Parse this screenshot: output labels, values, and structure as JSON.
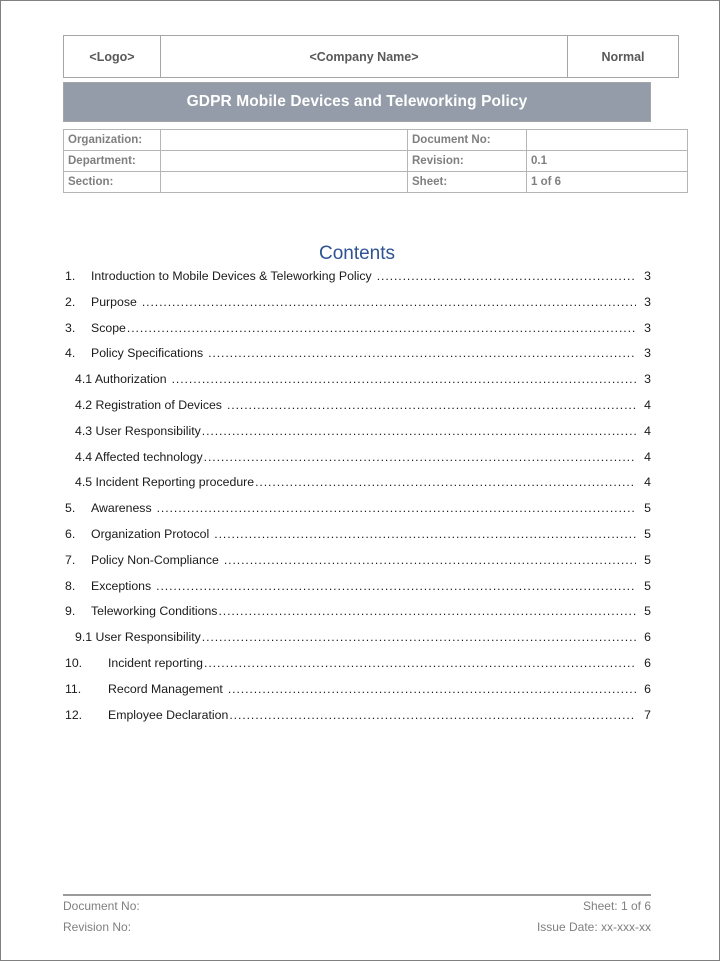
{
  "document": {
    "header_table": {
      "logo_cell": "<Logo>",
      "company_cell": "<Company Name>",
      "status_cell": "Normal"
    },
    "banner_title": "GDPR Mobile Devices and Teleworking Policy",
    "meta_table": {
      "rows": [
        {
          "label_left": "Organization:",
          "value_left": "",
          "label_right": "Document No:",
          "value_right": ""
        },
        {
          "label_left": "Department:",
          "value_left": "",
          "label_right": "Revision:",
          "value_right": "0.1"
        },
        {
          "label_left": "Section:",
          "value_left": "",
          "label_right": "Sheet:",
          "value_right": "1 of 6"
        }
      ]
    },
    "contents_heading": "Contents",
    "toc": [
      {
        "number": "1.",
        "label": "Introduction to Mobile Devices & Teleworking Policy",
        "page": "3",
        "level": 1
      },
      {
        "number": "2.",
        "label": "Purpose",
        "page": "3",
        "level": 1
      },
      {
        "number": "3.",
        "label": "Scope",
        "page": "3",
        "level": 1
      },
      {
        "number": "4.",
        "label": "Policy Specifications",
        "page": "3",
        "level": 1
      },
      {
        "number": "",
        "label": "4.1 Authorization",
        "page": "3",
        "level": 2
      },
      {
        "number": "",
        "label": "4.2 Registration of Devices",
        "page": "4",
        "level": 2
      },
      {
        "number": "",
        "label": "4.3 User Responsibility",
        "page": "4",
        "level": 2
      },
      {
        "number": "",
        "label": "4.4 Affected technology",
        "page": "4",
        "level": 2
      },
      {
        "number": "",
        "label": "4.5 Incident Reporting procedure",
        "page": "4",
        "level": 2
      },
      {
        "number": "5.",
        "label": "Awareness",
        "page": "5",
        "level": 1
      },
      {
        "number": "6.",
        "label": "Organization Protocol",
        "page": "5",
        "level": 1
      },
      {
        "number": "7.",
        "label": "Policy Non-Compliance",
        "page": "5",
        "level": 1
      },
      {
        "number": "8.",
        "label": "Exceptions",
        "page": "5",
        "level": 1
      },
      {
        "number": "9.",
        "label": "Teleworking Conditions",
        "page": "5",
        "level": 1
      },
      {
        "number": "",
        "label": "9.1 User Responsibility",
        "page": "6",
        "level": 2
      },
      {
        "number": "10.",
        "label": "Incident reporting",
        "page": "6",
        "level": 1
      },
      {
        "number": "11.",
        "label": "Record Management",
        "page": "6",
        "level": 1
      },
      {
        "number": "12.",
        "label": "Employee Declaration",
        "page": "7",
        "level": 1
      }
    ],
    "footer": {
      "document_no_label": "Document No:",
      "revision_no_label": "Revision No:",
      "sheet_text": "Sheet: 1 of 6",
      "issue_date_text": "Issue Date: xx-xxx-xx"
    }
  },
  "colors": {
    "banner_bg": "#939ca8",
    "heading_blue": "#2e5395",
    "meta_text": "#7f7f7f",
    "footer_text": "#808080"
  }
}
